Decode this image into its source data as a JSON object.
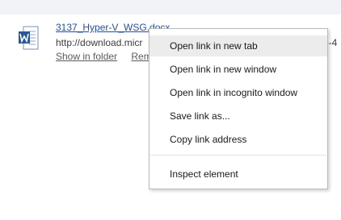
{
  "download": {
    "file_name": "3137_Hyper-V_WSG.docx",
    "url": "http://download.micr",
    "url_tail": "6-4",
    "show_in_folder": "Show in folder",
    "remove": "Rem",
    "icon": "word-doc-icon",
    "icon_color": "#2b579a"
  },
  "context_menu": {
    "items": [
      {
        "label": "Open link in new tab"
      },
      {
        "label": "Open link in new window"
      },
      {
        "label": "Open link in incognito window"
      },
      {
        "label": "Save link as..."
      },
      {
        "label": "Copy link address"
      },
      {
        "label": "Inspect element"
      }
    ]
  }
}
